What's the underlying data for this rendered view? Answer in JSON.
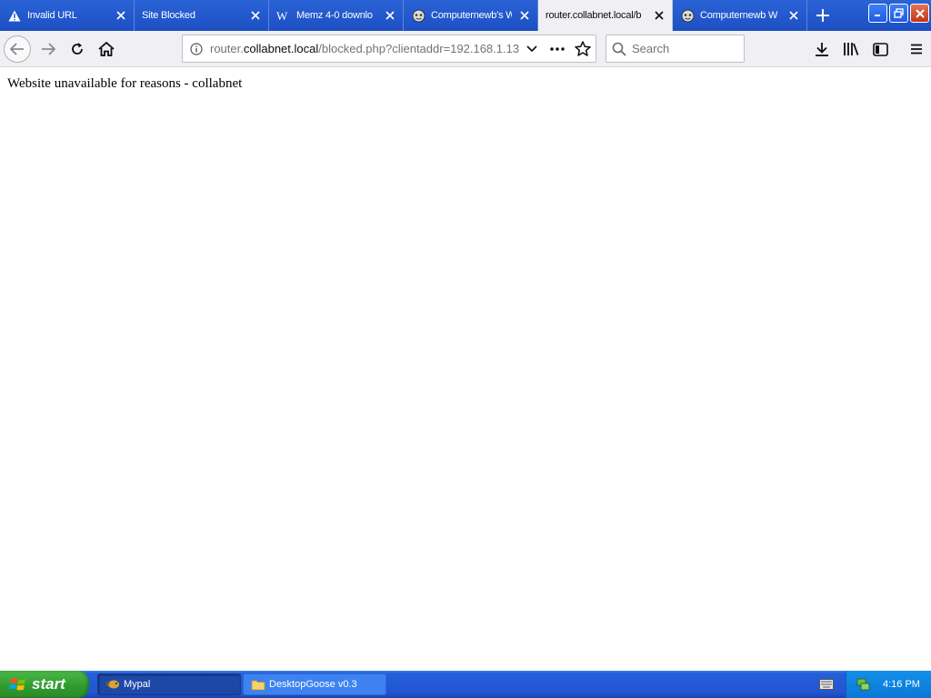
{
  "browser": {
    "tabs": [
      {
        "title": "Invalid URL",
        "icon": "warning-icon"
      },
      {
        "title": "Site Blocked",
        "icon": "none"
      },
      {
        "title": "Memz 4-0 downlo",
        "icon": "wikipedia-icon"
      },
      {
        "title": "Computernewb's W",
        "icon": "computernewb-icon"
      },
      {
        "title": "router.collabnet.local/b",
        "icon": "none",
        "active": true
      },
      {
        "title": "Computernewb W",
        "icon": "computernewb-icon"
      }
    ],
    "url": {
      "prefix": "router.",
      "host": "collabnet.local",
      "path": "/blocked.php?clientaddr=192.168.1.13"
    },
    "search": {
      "placeholder": "Search",
      "value": ""
    }
  },
  "page": {
    "message": "Website unavailable for reasons - collabnet"
  },
  "taskbar": {
    "start_label": "start",
    "tasks": [
      {
        "label": "Mypal",
        "icon": "mypal-icon",
        "active": true
      },
      {
        "label": "DesktopGoose v0.3",
        "icon": "folder-icon",
        "active": false
      }
    ],
    "clock": "4:16 PM"
  },
  "colors": {
    "tabstrip": "#1d4fc4",
    "active_tab": "#f0f0f4",
    "taskbar": "#245edb",
    "start": "#3a9e38",
    "tray": "#0b77d6"
  }
}
